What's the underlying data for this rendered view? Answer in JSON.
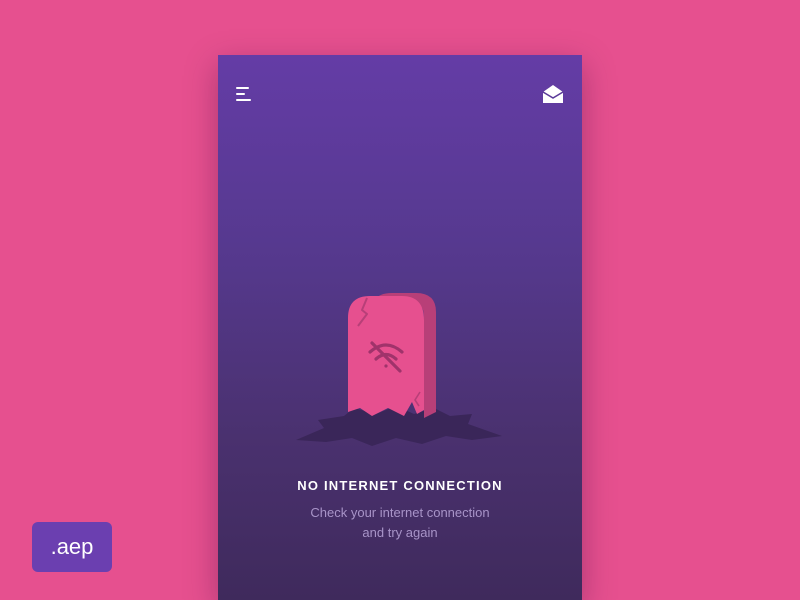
{
  "header": {
    "menu_icon": "menu-icon",
    "mail_icon": "envelope-open-icon"
  },
  "illustration": {
    "icon": "broken-tombstone-no-wifi-icon",
    "colors": {
      "stone": "#E6508F",
      "ground": "#3A2659"
    }
  },
  "message": {
    "title": "NO INTERNET CONNECTION",
    "line1": "Check your internet connection",
    "line2": "and try again"
  },
  "badge": {
    "label": ".aep"
  },
  "colors": {
    "background": "#E6508F",
    "gradient_top": "#643CA6",
    "gradient_bottom": "#3F2A5C",
    "badge": "#6B3FB0"
  }
}
